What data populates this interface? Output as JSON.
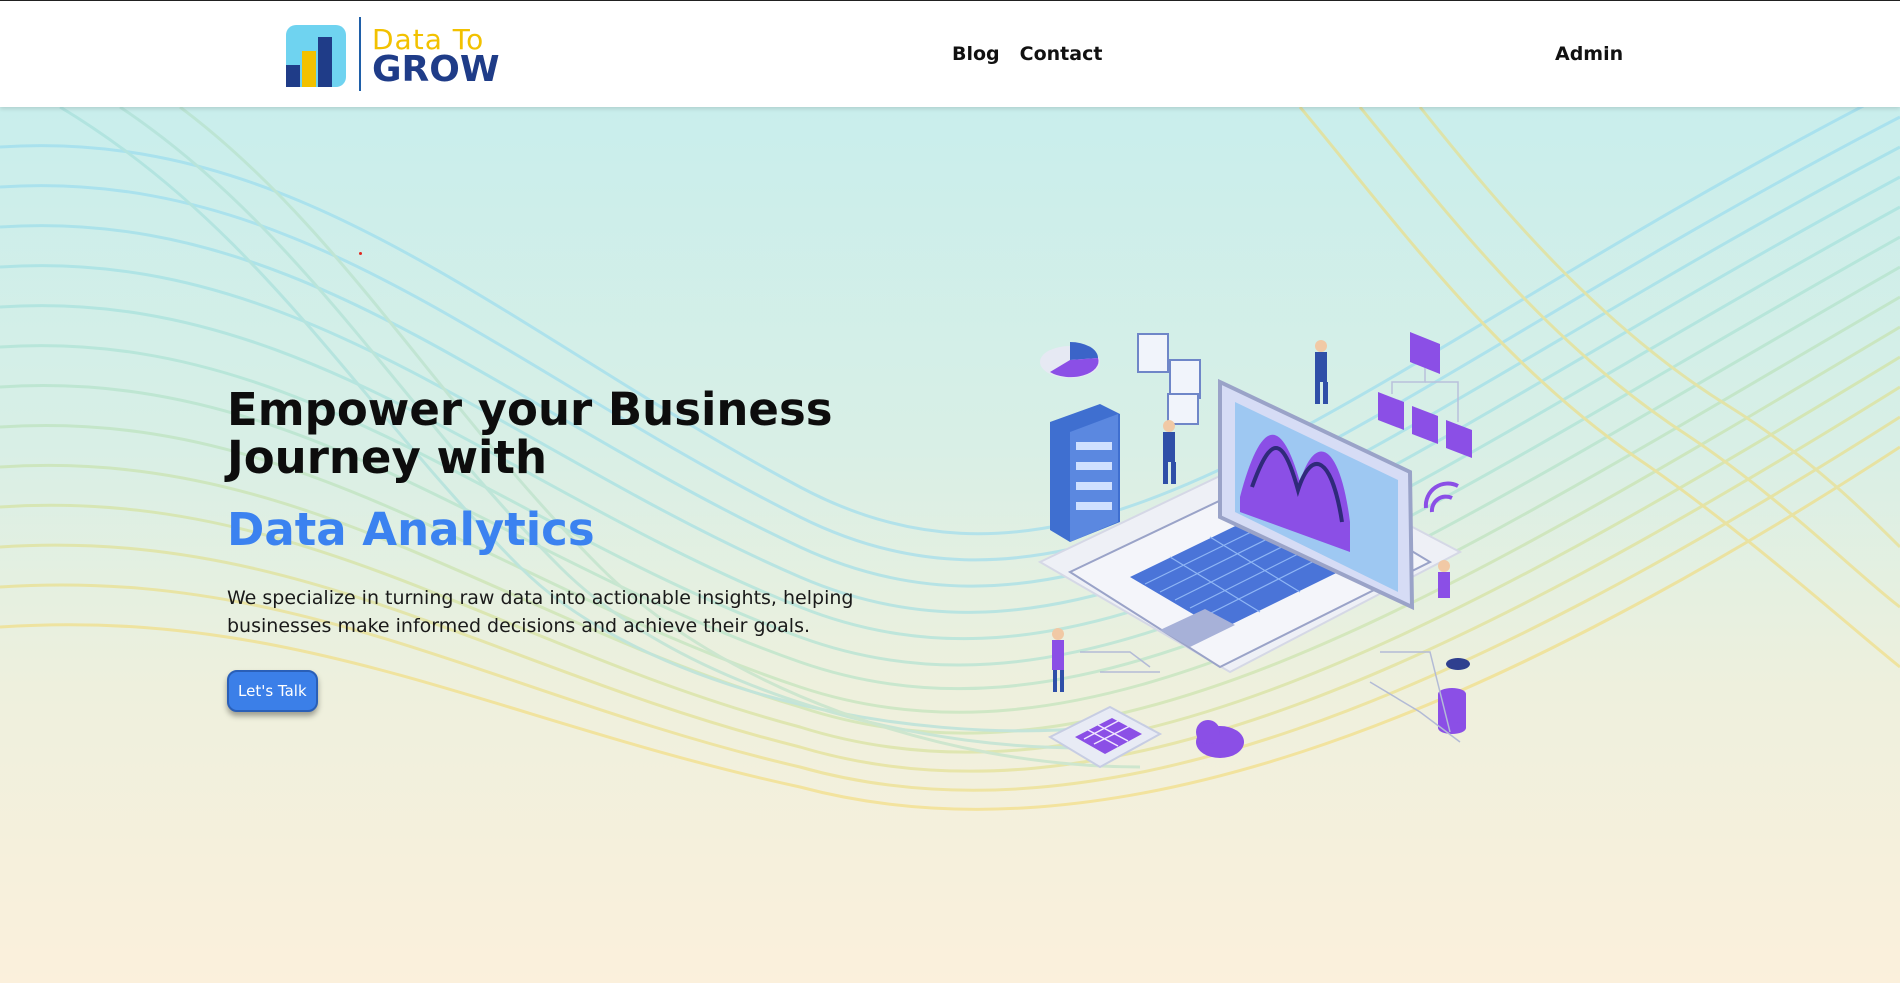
{
  "header": {
    "logo": {
      "line1": "Data To",
      "line2": "GROW"
    },
    "nav": [
      {
        "label": "Blog"
      },
      {
        "label": "Contact"
      }
    ],
    "admin_label": "Admin"
  },
  "hero": {
    "title": "Empower your Business Journey with",
    "accent": "Data Analytics",
    "description": "We specialize in turning raw data into actionable insights, helping businesses make informed decisions and achieve their goals.",
    "cta_label": "Let's Talk"
  },
  "colors": {
    "accent_blue": "#3b82f0",
    "logo_yellow": "#f2c100",
    "logo_navy": "#1f3c88",
    "illustration_purple": "#8b4fe6"
  }
}
